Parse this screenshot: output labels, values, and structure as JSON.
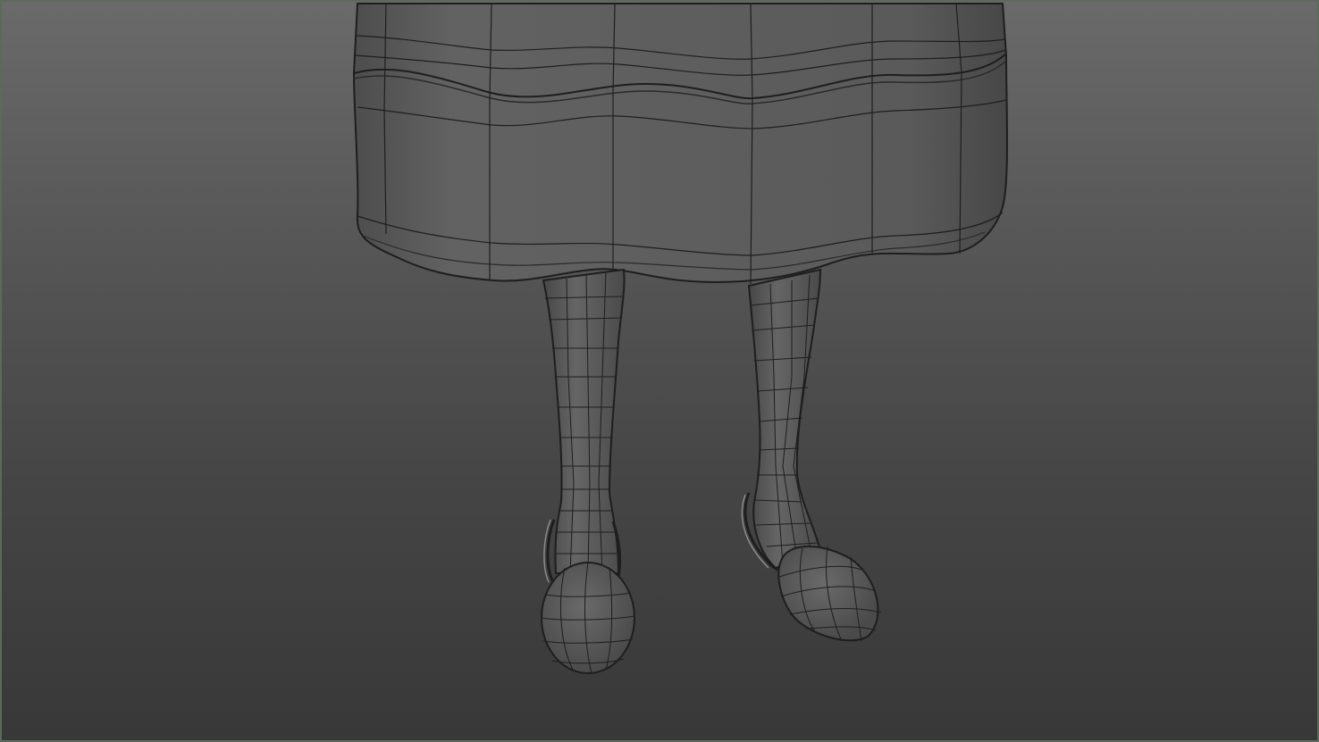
{
  "viewport": {
    "background_top": "#6a6a6a",
    "background_bottom": "#383838",
    "border_color": "#5a6b5a"
  },
  "model": {
    "shade_color": "#5c5c5c",
    "wire_color": "#1e1e1e",
    "parts": [
      "skirt",
      "left-leg",
      "right-leg",
      "left-shoe",
      "right-shoe"
    ]
  }
}
